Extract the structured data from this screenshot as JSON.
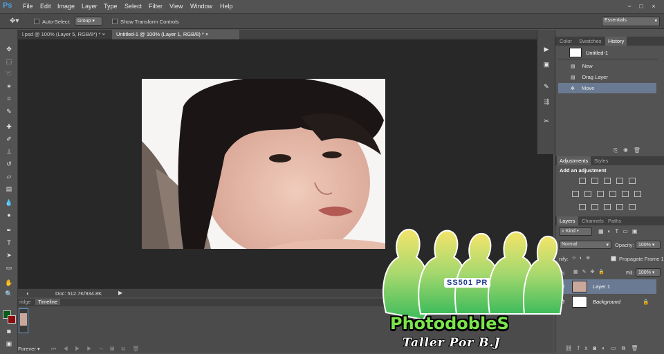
{
  "app": {
    "logo": "Ps",
    "workspace": "Essentials"
  },
  "menu": [
    "File",
    "Edit",
    "Image",
    "Layer",
    "Type",
    "Select",
    "Filter",
    "View",
    "Window",
    "Help"
  ],
  "window_controls": {
    "minimize": "−",
    "maximize": "□",
    "close": "×"
  },
  "options": {
    "auto_select_label": "Auto-Select:",
    "auto_select_value": "Group",
    "transform_label": "Show Transform Controls"
  },
  "tabs": [
    {
      "label": "l.psd @ 100% (Layer 5, RGB/8*) *",
      "close": "×"
    },
    {
      "label": "Untitled-1 @ 100% (Layer 1, RGB/8) *",
      "close": "×"
    }
  ],
  "status": {
    "doc": "Doc: 512.7K/934.8K"
  },
  "bottom_tabs": [
    "ridge",
    "Timeline"
  ],
  "timeline": {
    "loop": "Forever"
  },
  "panels": {
    "top_tabs": [
      "Color",
      "Swatches",
      "History"
    ],
    "history": {
      "snapshot": "Untitled-1",
      "items": [
        "New",
        "Drag Layer",
        "Move"
      ]
    },
    "adj_tabs": [
      "Adjustments",
      "Styles"
    ],
    "adj_title": "Add an adjustment",
    "layer_tabs": [
      "Layers",
      "Channels",
      "Paths"
    ],
    "kind": "Kind",
    "blend": "Normal",
    "opacity_label": "Opacity:",
    "opacity_value": "100%",
    "lock_label": "ck:",
    "unify_label": "nify:",
    "propagate": "Propagate Frame 1",
    "fill_label": "Fill:",
    "fill_value": "100%",
    "layers": [
      "Layer 1",
      "Background"
    ]
  },
  "watermark": {
    "title": "PhotodobleS",
    "subtitle": "Taller Por B.J",
    "badge": "SS501 PR"
  }
}
